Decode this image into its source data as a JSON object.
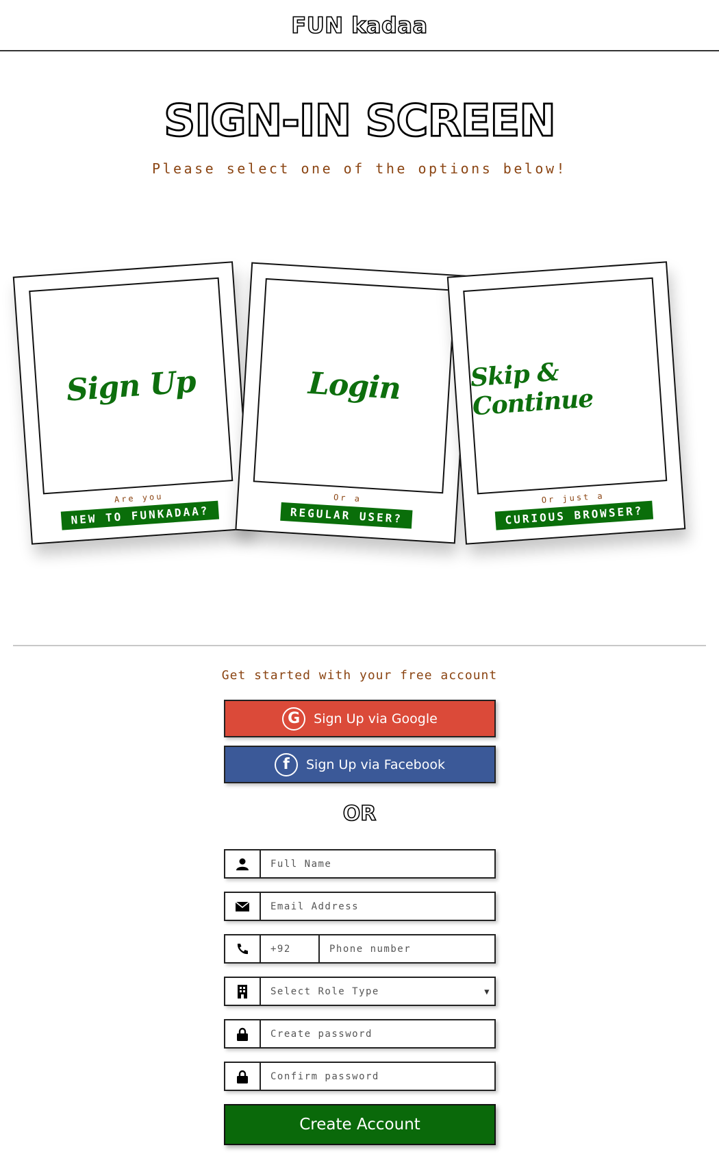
{
  "header": {
    "brand": "FUN kadaa"
  },
  "hero": {
    "title": "SIGN-IN SCREEN",
    "subtitle": "Please select one of the options below!"
  },
  "cards": [
    {
      "title": "Sign Up",
      "small": "Are you",
      "tag": "NEW TO FUNKADAA?"
    },
    {
      "title": "Login",
      "small": "Or a",
      "tag": "REGULAR USER?"
    },
    {
      "title": "Skip & Continue",
      "small": "Or just a",
      "tag": "CURIOUS BROWSER?"
    }
  ],
  "signup": {
    "heading": "Get started with your free account",
    "google_label": "Sign Up via Google",
    "facebook_label": "Sign Up via Facebook",
    "or_label": "OR",
    "full_name_placeholder": "Full Name",
    "email_placeholder": "Email Address",
    "country_code": "+92",
    "phone_placeholder": "Phone number",
    "role_selected": "Select Role Type",
    "password_placeholder": "Create password",
    "confirm_placeholder": "Confirm password",
    "create_label": "Create Account"
  },
  "icons": {
    "user": "user-icon",
    "email": "envelope-icon",
    "phone": "phone-icon",
    "role": "building-icon",
    "lock": "lock-icon",
    "google": "google-icon",
    "facebook": "facebook-icon"
  },
  "colors": {
    "green": "#0a6e0a",
    "brown": "#8b4513",
    "google_red": "#db4a39",
    "facebook_blue": "#3b5998"
  }
}
